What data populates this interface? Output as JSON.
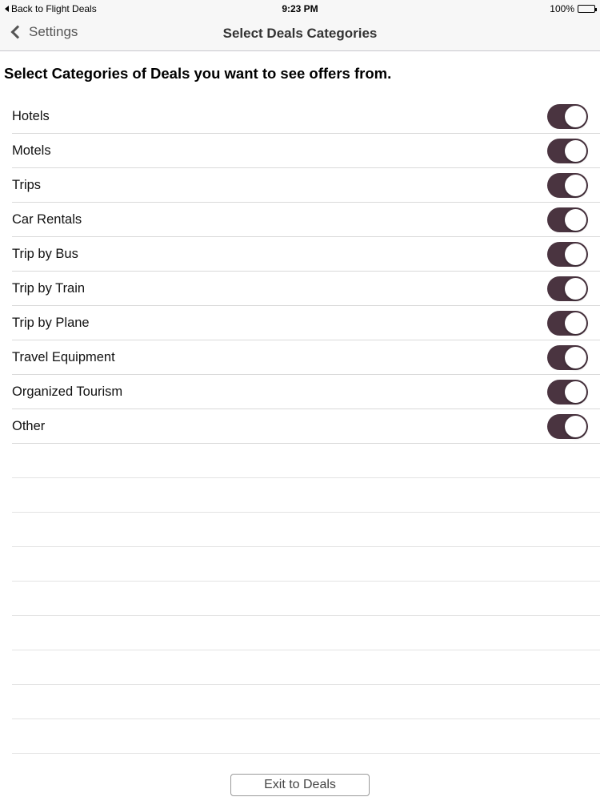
{
  "status_bar": {
    "back_label": "Back to Flight Deals",
    "time": "9:23 PM",
    "battery": "100%"
  },
  "nav": {
    "back_label": "Settings",
    "title": "Select Deals Categories"
  },
  "heading": "Select Categories of Deals you want to see offers from.",
  "categories": [
    {
      "label": "Hotels",
      "enabled": true
    },
    {
      "label": "Motels",
      "enabled": true
    },
    {
      "label": "Trips",
      "enabled": true
    },
    {
      "label": "Car Rentals",
      "enabled": true
    },
    {
      "label": "Trip by Bus",
      "enabled": true
    },
    {
      "label": "Trip by Train",
      "enabled": true
    },
    {
      "label": "Trip by Plane",
      "enabled": true
    },
    {
      "label": "Travel Equipment",
      "enabled": true
    },
    {
      "label": "Organized Tourism",
      "enabled": true
    },
    {
      "label": "Other",
      "enabled": true
    }
  ],
  "exit_button_label": "Exit to Deals",
  "colors": {
    "toggle_on": "#4a3440",
    "nav_background": "#f7f7f7"
  }
}
